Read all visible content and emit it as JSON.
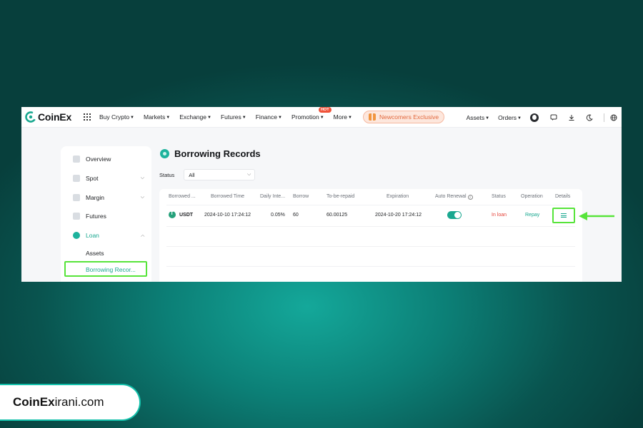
{
  "brand": {
    "logo_text": "CoinEx",
    "logo_color": "#1aa890"
  },
  "nav": {
    "items": [
      {
        "label": "Buy Crypto"
      },
      {
        "label": "Markets"
      },
      {
        "label": "Exchange"
      },
      {
        "label": "Futures"
      },
      {
        "label": "Finance"
      },
      {
        "label": "Promotion",
        "badge": "HOT"
      },
      {
        "label": "More"
      }
    ],
    "newcomers": "Newcomers Exclusive",
    "right": [
      {
        "label": "Assets"
      },
      {
        "label": "Orders"
      }
    ],
    "icons": [
      "avatar-icon",
      "message-icon",
      "download-icon",
      "moon-icon",
      "globe-icon"
    ]
  },
  "sidebar": {
    "items": [
      {
        "label": "Overview",
        "icon": "overview-icon"
      },
      {
        "label": "Spot",
        "icon": "spot-icon"
      },
      {
        "label": "Margin",
        "icon": "margin-icon"
      },
      {
        "label": "Futures",
        "icon": "futures-icon"
      },
      {
        "label": "Loan",
        "icon": "loan-icon"
      }
    ],
    "sub_items": [
      {
        "label": "Assets"
      },
      {
        "label": "Borrowing Recor..."
      }
    ]
  },
  "page": {
    "title": "Borrowing Records",
    "filter_label": "Status",
    "filter_value": "All"
  },
  "table": {
    "headers": [
      "Borrowed ...",
      "Borrowed Time",
      "Daily Inte...",
      "Borrow",
      "To-be-repaid",
      "Expiration",
      "Auto Renewal",
      "Status",
      "Operation",
      "Details"
    ],
    "rows": [
      {
        "coin": "USDT",
        "borrowed_time": "2024-10-10 17:24:12",
        "daily_interest": "0.05%",
        "borrow": "60",
        "to_be_repaid": "60.00125",
        "expiration": "2024-10-20 17:24:12",
        "auto_renewal": true,
        "status": "In loan",
        "operation": "Repay"
      }
    ]
  },
  "footer_brand": {
    "bold": "CoinEx",
    "rest": "irani.com"
  },
  "colors": {
    "accent": "#1aa890",
    "highlight": "#57e43a",
    "status_red": "#e5453b"
  }
}
